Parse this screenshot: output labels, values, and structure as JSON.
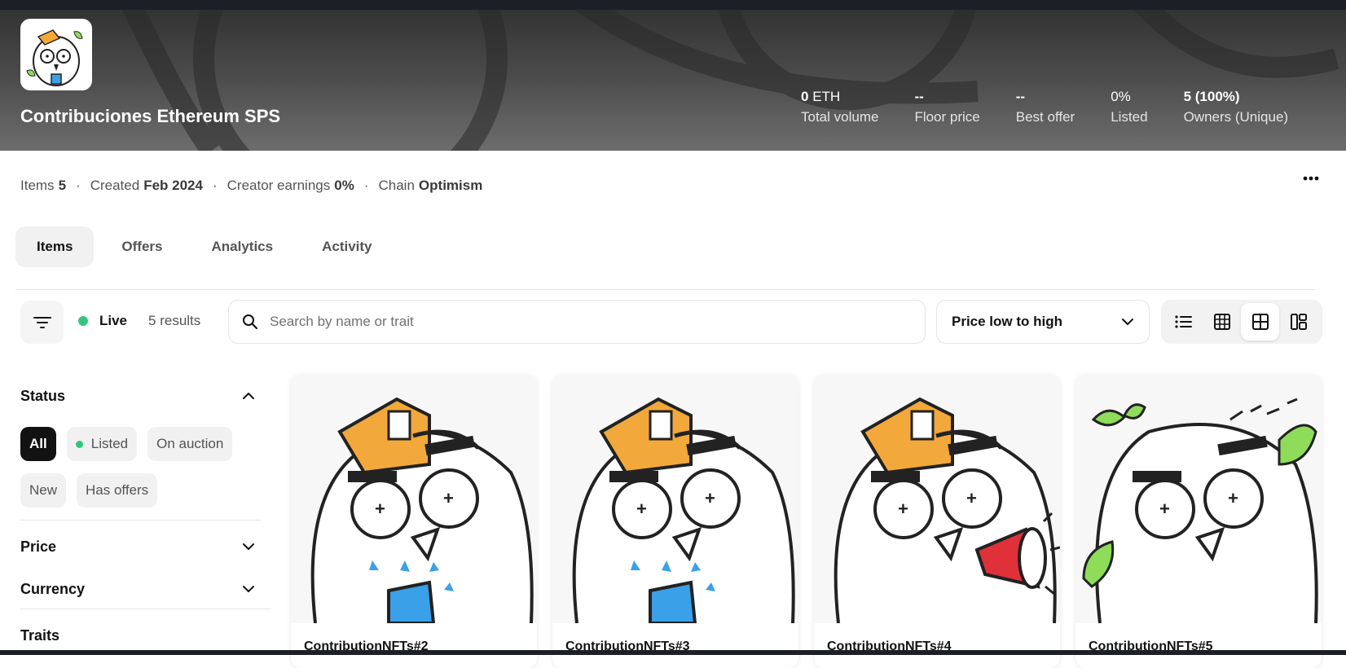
{
  "collection": {
    "title": "Contribuciones Ethereum SPS",
    "stats": [
      {
        "value_bold": "0",
        "value_rest": " ETH",
        "label": "Total volume"
      },
      {
        "value_bold": "--",
        "value_rest": "",
        "label": "Floor price"
      },
      {
        "value_bold": "--",
        "value_rest": "",
        "label": "Best offer"
      },
      {
        "value_bold": "",
        "value_rest": "0%",
        "label": "Listed"
      },
      {
        "value_bold": "5 (100%)",
        "value_rest": "",
        "label": "Owners (Unique)"
      }
    ]
  },
  "meta": {
    "items_label": "Items",
    "items_value": "5",
    "created_label": "Created",
    "created_value": "Feb 2024",
    "earnings_label": "Creator earnings",
    "earnings_value": "0%",
    "chain_label": "Chain",
    "chain_value": "Optimism",
    "separator": "·"
  },
  "tabs": [
    {
      "label": "Items",
      "active": true
    },
    {
      "label": "Offers"
    },
    {
      "label": "Analytics"
    },
    {
      "label": "Activity"
    }
  ],
  "toolbar": {
    "live_label": "Live",
    "results": "5 results",
    "search_placeholder": "Search by name or trait",
    "sort_selected": "Price low to high"
  },
  "sidebar": {
    "status_title": "Status",
    "status_chips": [
      "All",
      "Listed",
      "On auction",
      "New",
      "Has offers"
    ],
    "price_title": "Price",
    "currency_title": "Currency",
    "traits_title": "Traits"
  },
  "items": [
    {
      "name": "ContributionNFTs#2",
      "variant": "book"
    },
    {
      "name": "ContributionNFTs#3",
      "variant": "book"
    },
    {
      "name": "ContributionNFTs#4",
      "variant": "megaphone"
    },
    {
      "name": "ContributionNFTs#5",
      "variant": "leaves"
    }
  ],
  "colors": {
    "accent_live": "#34c77b",
    "hat_orange": "#f2a83a",
    "book_blue": "#3aa0e8",
    "leaf_green": "#8edc5a",
    "megaphone_red": "#e0303a"
  },
  "icons": [
    "filter-icon",
    "search-icon",
    "chevron-down-icon",
    "chevron-up-icon",
    "list-view-icon",
    "small-grid-icon",
    "grid-view-icon",
    "masonry-icon",
    "more-icon"
  ]
}
